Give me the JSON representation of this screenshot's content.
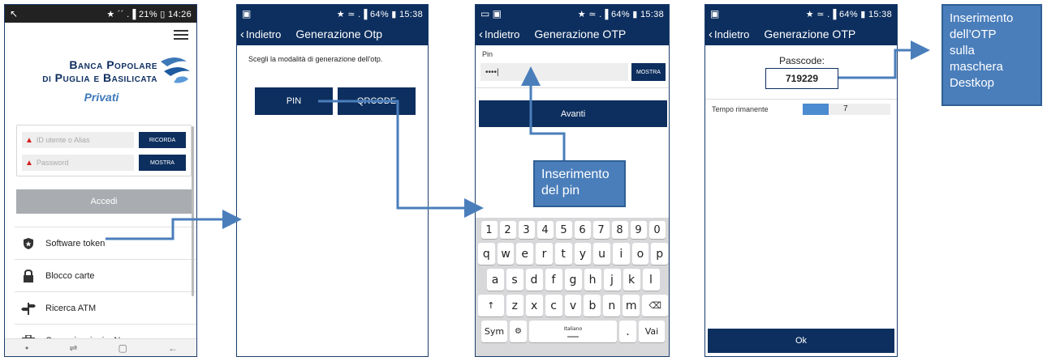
{
  "phone1": {
    "status_left": "↖",
    "status_right": "★ ´´ .▐ 21% ▯ 14:26",
    "bank_name_line1": "Banca Popolare",
    "bank_name_line2": "di Puglia e Basilicata",
    "subtitle": "Privati",
    "user_placeholder": "ID utente o Alias",
    "ricorda_label": "RICORDA",
    "password_placeholder": "Password",
    "mostra_label": "MOSTRA",
    "accedi_label": "Accedi",
    "menu": [
      {
        "label": "Software token",
        "icon": "shield-star-icon"
      },
      {
        "label": "Blocco carte",
        "icon": "lock-icon"
      },
      {
        "label": "Ricerca ATM",
        "icon": "signpost-icon"
      },
      {
        "label": "Comunicazioni e News",
        "icon": "briefcase-icon"
      }
    ]
  },
  "phone2": {
    "status_right": "★ ≃ .▐ 64% ▮ 15:38",
    "back_label": "Indietro",
    "title": "Generazione Otp",
    "instruction": "Scegli la modalità di generazione dell'otp.",
    "pin_label": "PIN",
    "qrcode_label": "QRCODE"
  },
  "phone3": {
    "status_right": "★ ≃ .▐ 64% ▮ 15:38",
    "back_label": "Indietro",
    "title": "Generazione OTP",
    "pin_label": "Pin",
    "pin_value": "••••|",
    "mostra_label": "MOSTRA",
    "avanti_label": "Avanti",
    "keyboard": {
      "row_numbers": [
        "1",
        "2",
        "3",
        "4",
        "5",
        "6",
        "7",
        "8",
        "9",
        "0"
      ],
      "row1": [
        "q",
        "w",
        "e",
        "r",
        "t",
        "y",
        "u",
        "i",
        "o",
        "p"
      ],
      "row2": [
        "a",
        "s",
        "d",
        "f",
        "g",
        "h",
        "j",
        "k",
        "l"
      ],
      "row3": [
        "z",
        "x",
        "c",
        "v",
        "b",
        "n",
        "m"
      ],
      "shift": "↑",
      "backspace": "⌫",
      "sym": "Sym",
      "language": "Italiano",
      "period": ".",
      "go": "Vai"
    }
  },
  "phone4": {
    "status_right": "★ ≃ .▐ 64% ▮ 15:38",
    "back_label": "Indietro",
    "title": "Generazione OTP",
    "passcode_label": "Passcode:",
    "passcode_value": "719229",
    "tempo_label": "Tempo rimanente",
    "tempo_value": "7",
    "tempo_fraction": 0.3,
    "ok_label": "Ok"
  },
  "callouts": {
    "pin_line1": "Inserimento",
    "pin_line2": "del pin",
    "otp_line1": "Inserimento",
    "otp_line2": "dell’OTP",
    "otp_line3": "sulla",
    "otp_line4": "maschera",
    "otp_line5": "Destkop"
  },
  "colors": {
    "brand_navy": "#0d2f5f",
    "callout_blue": "#4a7ebb",
    "timer_fill": "#4b8bd0"
  }
}
